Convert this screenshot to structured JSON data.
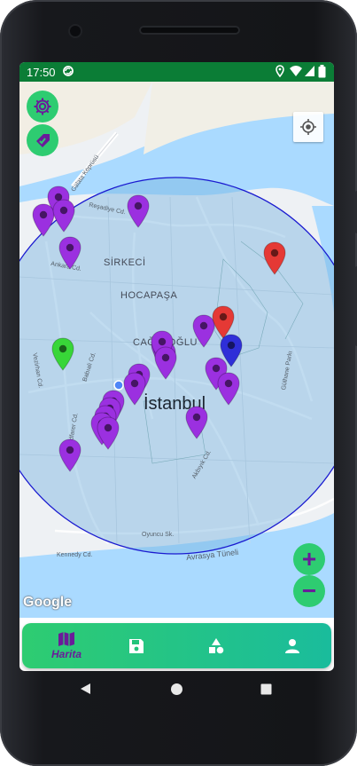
{
  "status_bar": {
    "time": "17:50",
    "left_icons": [
      "sync-icon"
    ],
    "right_icons": [
      "location-icon",
      "wifi-icon",
      "signal-icon",
      "battery-icon"
    ]
  },
  "map": {
    "attribution": "Google",
    "district_labels": [
      "SİRKECİ",
      "HOCAPAŞA",
      "CAĞALOĞLU"
    ],
    "city_label": "İstanbul",
    "street_labels": [
      "Reşadiye Cd.",
      "Ankara Cd.",
      "Babıali Cd.",
      "Vezirhan Cd.",
      "Klodfarer Cd.",
      "Akbıyık Cd.",
      "Oyuncu Sk.",
      "Kennedy Cd.",
      "Avrasya Tüneli",
      "Gülhane Parkı",
      "Galata Köprüsü"
    ],
    "markers": {
      "purple": 21,
      "red": 2,
      "blue": 1,
      "green": 1
    },
    "colors": {
      "water": "#aadaff",
      "land": "#eef1f4",
      "radius_fill": "rgba(120,180,225,0.45)",
      "radius_stroke": "#1a1ad0",
      "purple_marker": "#9b30e0",
      "red_marker": "#e53935",
      "blue_marker": "#2f2fd8",
      "green_marker": "#38d638"
    }
  },
  "controls": {
    "settings_icon": "gear-icon",
    "filter_icon": "tag-check-icon",
    "my_location_icon": "crosshair-icon",
    "zoom_in": "+",
    "zoom_out": "−"
  },
  "bottom_nav": {
    "active_index": 0,
    "active_label_color": "#6a1b9a",
    "items": [
      {
        "label": "Harita",
        "icon": "map-icon"
      },
      {
        "label": "",
        "icon": "save-icon"
      },
      {
        "label": "",
        "icon": "shapes-icon"
      },
      {
        "label": "",
        "icon": "person-icon"
      }
    ]
  },
  "system_nav": [
    "back-icon",
    "home-icon",
    "recents-icon"
  ]
}
